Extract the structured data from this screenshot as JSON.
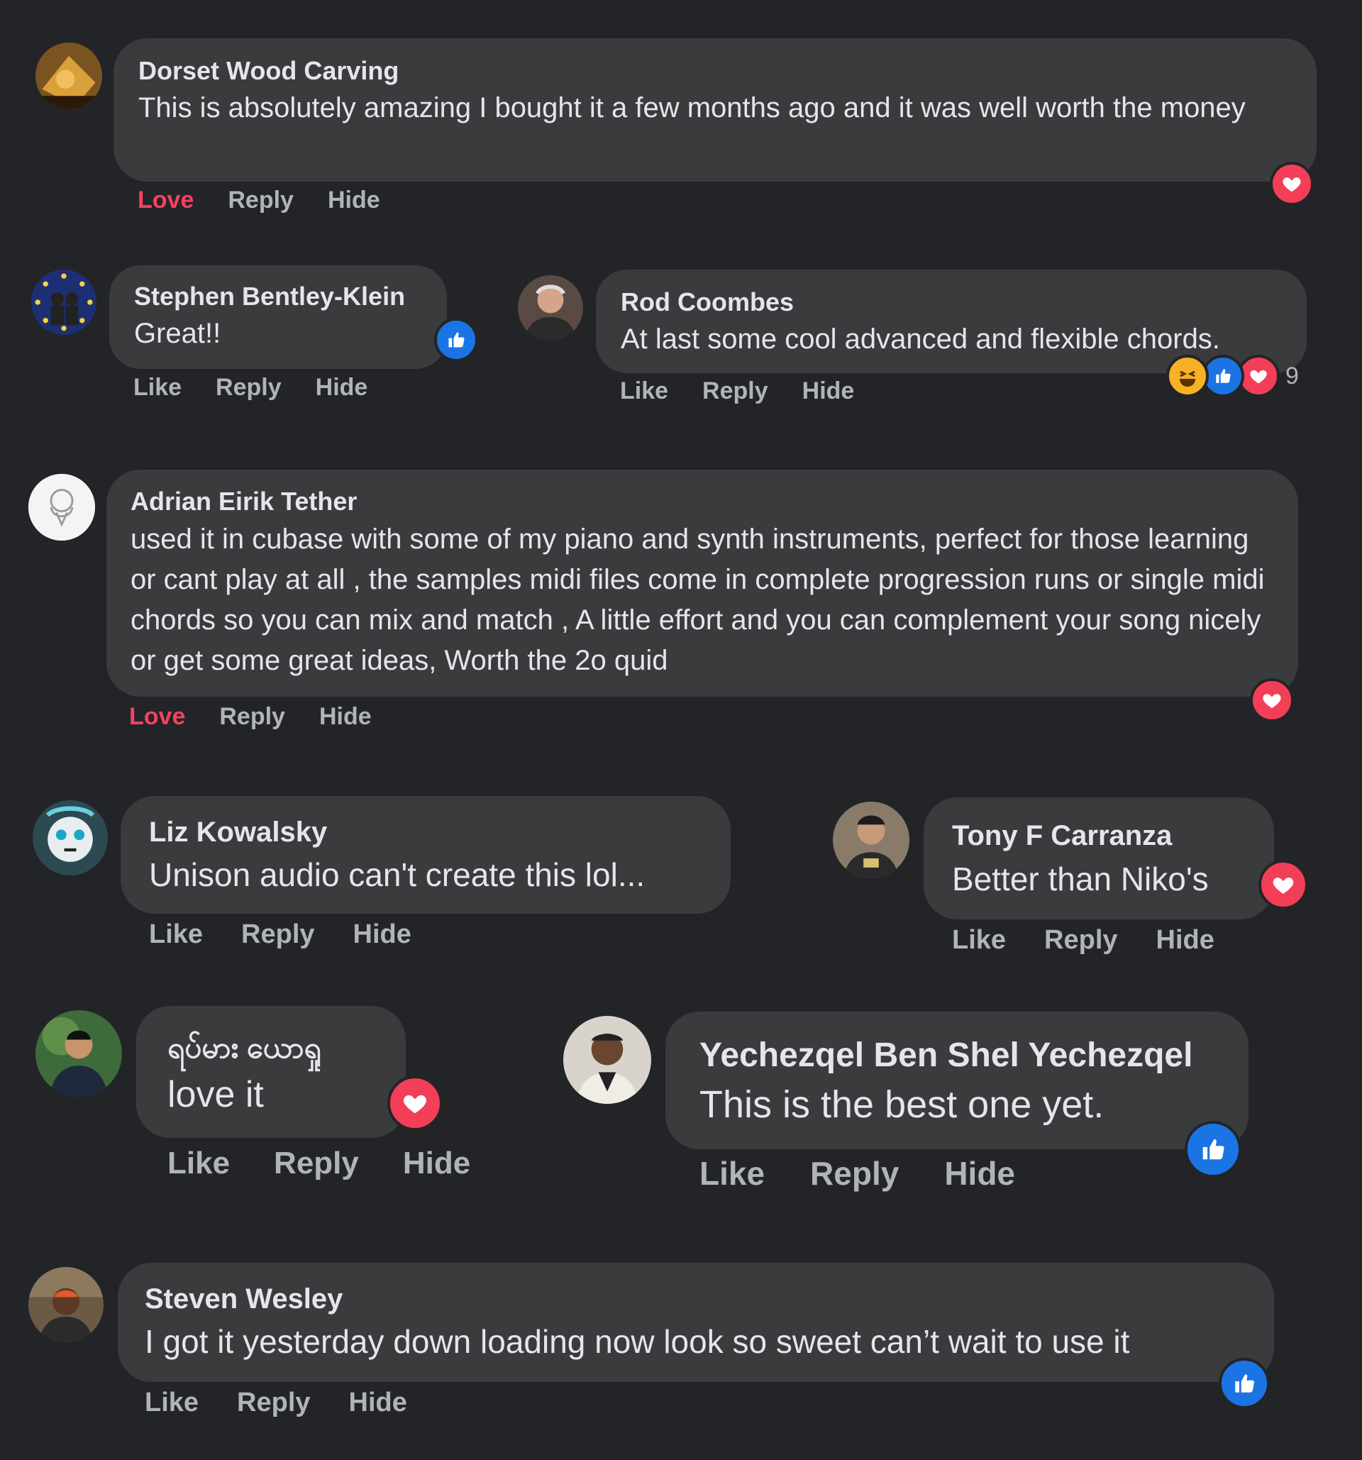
{
  "colors": {
    "background": "#232427",
    "bubble": "#3a3b3c",
    "love": "#f3425f",
    "like": "#1b74e4",
    "action": "#b0b3b8"
  },
  "comments": [
    {
      "author": "Dorset Wood Carving",
      "text": "This is absolutely amazing I bought it a few months ago and it was well worth the money",
      "actions": [
        "Love",
        "Reply",
        "Hide"
      ],
      "reaction": "heart-icon"
    },
    {
      "author": "Stephen Bentley-Klein",
      "text": "Great!!",
      "actions": [
        "Like",
        "Reply",
        "Hide"
      ],
      "reaction": "like-icon"
    },
    {
      "author": "Rod Coombes",
      "text": "At last some cool advanced and flexible chords.",
      "actions": [
        "Like",
        "Reply",
        "Hide"
      ],
      "reactions": [
        "haha-icon",
        "like-icon",
        "heart-icon"
      ],
      "reaction_count": "9"
    },
    {
      "author": "Adrian Eirik Tether",
      "text": "used it in cubase with some of my piano and synth instruments, perfect for those learning or cant play at all , the samples midi files come in complete progression runs or single midi chords so you can mix and match , A little effort and you can complement your song nicely or get some great ideas, Worth the 2o quid",
      "actions": [
        "Love",
        "Reply",
        "Hide"
      ],
      "reaction": "heart-icon"
    },
    {
      "author": "Liz Kowalsky",
      "text": "Unison audio can't create this lol...",
      "actions": [
        "Like",
        "Reply",
        "Hide"
      ]
    },
    {
      "author": "Tony F Carranza",
      "text": "Better than Niko's",
      "actions": [
        "Like",
        "Reply",
        "Hide"
      ],
      "reaction": "heart-icon"
    },
    {
      "author": "ရပ်မား ယောရှု",
      "text": "love it",
      "actions": [
        "Like",
        "Reply",
        "Hide"
      ],
      "reaction": "heart-icon"
    },
    {
      "author": "Yechezqel Ben Shel Yechezqel",
      "text": "This is the best one yet.",
      "actions": [
        "Like",
        "Reply",
        "Hide"
      ],
      "reaction": "like-icon"
    },
    {
      "author": "Steven Wesley",
      "text": "I got it yesterday down loading now look so sweet can’t wait to use it",
      "actions": [
        "Like",
        "Reply",
        "Hide"
      ],
      "reaction": "like-icon"
    }
  ]
}
